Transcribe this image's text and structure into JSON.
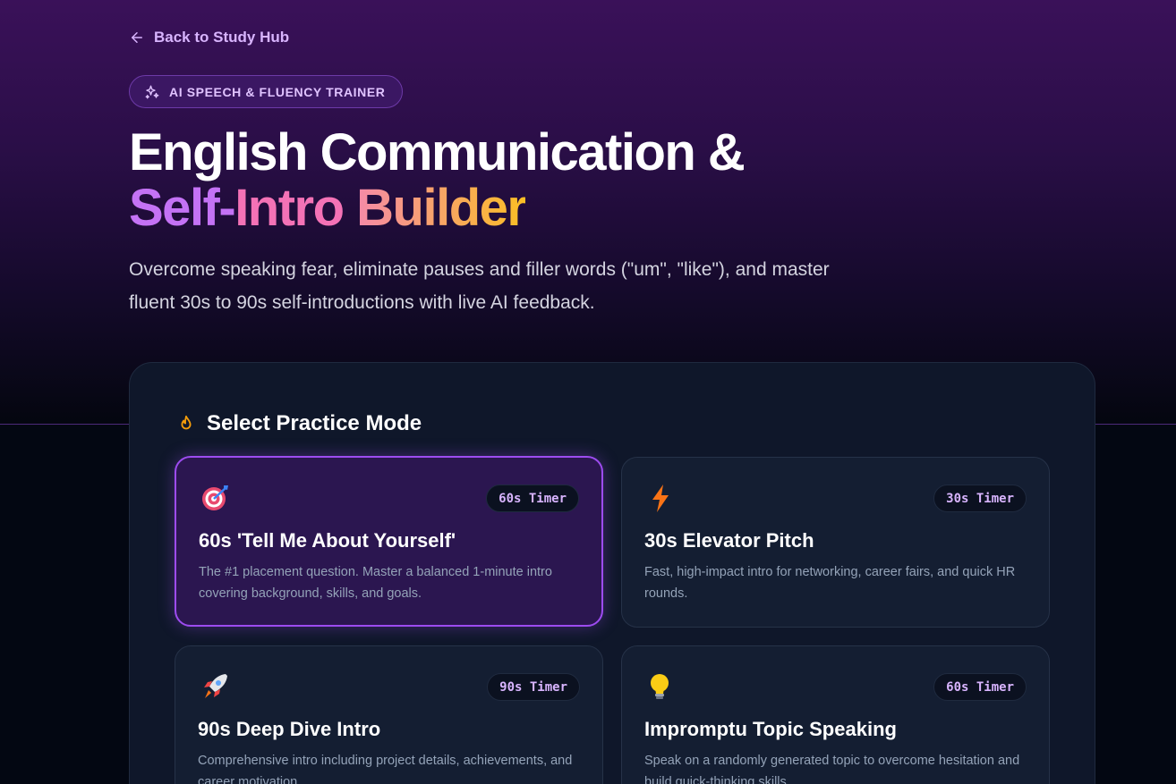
{
  "nav": {
    "back_label": "Back to Study Hub"
  },
  "badge": {
    "label": "AI SPEECH & FLUENCY TRAINER"
  },
  "hero": {
    "title_line1": "English Communication &",
    "title_part_a": "Self-",
    "title_part_b": "Intro",
    "title_part_c": "Builder",
    "subtitle": "Overcome speaking fear, eliminate pauses and filler words (\"um\", \"like\"), and master fluent 30s to 90s self-introductions with live AI feedback."
  },
  "practice": {
    "heading": "Select Practice Mode",
    "modes": [
      {
        "icon": "target-icon",
        "timer": "60s Timer",
        "title": "60s 'Tell Me About Yourself'",
        "description": "The #1 placement question. Master a balanced 1-minute intro covering background, skills, and goals.",
        "selected": true
      },
      {
        "icon": "lightning-icon",
        "timer": "30s Timer",
        "title": "30s Elevator Pitch",
        "description": "Fast, high-impact intro for networking, career fairs, and quick HR rounds.",
        "selected": false
      },
      {
        "icon": "rocket-icon",
        "timer": "90s Timer",
        "title": "90s Deep Dive Intro",
        "description": "Comprehensive intro including project details, achievements, and career motivation.",
        "selected": false
      },
      {
        "icon": "lightbulb-icon",
        "timer": "60s Timer",
        "title": "Impromptu Topic Speaking",
        "description": "Speak on a randomly generated topic to overcome hesitation and build quick-thinking skills.",
        "selected": false
      }
    ]
  },
  "colors": {
    "accent": "#9d4cf0",
    "badge_text": "#e0c3ff",
    "timer_text": "#d8b4fe"
  }
}
